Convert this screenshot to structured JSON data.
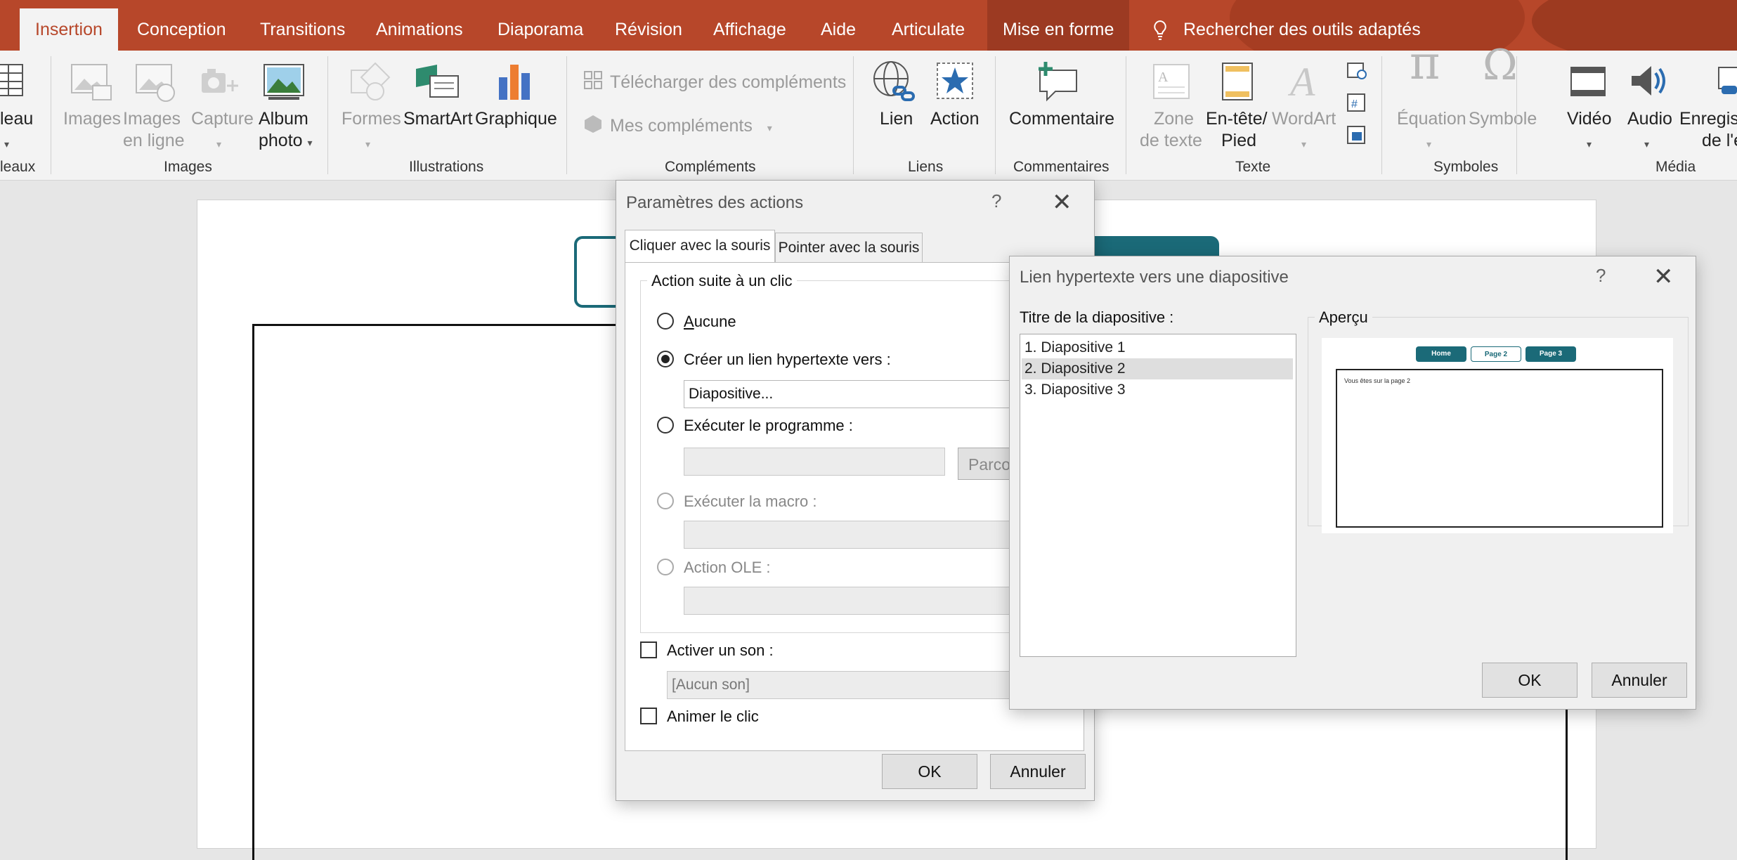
{
  "tabs": [
    "Insertion",
    "Conception",
    "Transitions",
    "Animations",
    "Diaporama",
    "Révision",
    "Affichage",
    "Aide",
    "Articulate",
    "Mise en forme"
  ],
  "search_text": "Rechercher des outils adaptés",
  "ribbon": {
    "tableau_partial": "leau",
    "tableaux_partial": "leaux",
    "images": "Images",
    "images_en_ligne_1": "Images",
    "images_en_ligne_2": "en ligne",
    "capture": "Capture",
    "album_photo_1": "Album",
    "album_photo_2": "photo",
    "group_images": "Images",
    "formes": "Formes",
    "smartart": "SmartArt",
    "graphique": "Graphique",
    "group_illustrations": "Illustrations",
    "telecharger": "Télécharger des compléments",
    "mes_complements": "Mes compléments",
    "group_complements": "Compléments",
    "lien": "Lien",
    "action": "Action",
    "group_liens": "Liens",
    "commentaire": "Commentaire",
    "group_commentaires": "Commentaires",
    "zone_texte_1": "Zone",
    "zone_texte_2": "de texte",
    "entete_1": "En-tête/",
    "entete_2": "Pied",
    "wordart": "WordArt",
    "group_texte": "Texte",
    "equation": "Équation",
    "symbole": "Symbole",
    "group_symboles": "Symboles",
    "video": "Vidéo",
    "audio": "Audio",
    "enregistrer_1": "Enregist",
    "enregistrer_2": "de l'é",
    "group_media": "Média"
  },
  "dialog_actions": {
    "title": "Paramètres des actions",
    "help": "?",
    "tab_click": "Cliquer avec la souris",
    "tab_hover": "Pointer avec la souris",
    "group_label": "Action suite à un clic",
    "opt_none": "Aucune",
    "opt_link": "Créer un lien hypertexte vers :",
    "link_value": "Diapositive...",
    "opt_program": "Exécuter le programme :",
    "browse": "Parcou",
    "opt_macro": "Exécuter la macro :",
    "opt_ole": "Action OLE :",
    "chk_sound": "Activer un son :",
    "sound_value": "[Aucun son]",
    "chk_animate": "Animer le clic",
    "ok": "OK",
    "cancel": "Annuler"
  },
  "dialog_link": {
    "title": "Lien hypertexte vers une diapositive",
    "help": "?",
    "list_label": "Titre de la diapositive :",
    "slides": [
      "1. Diapositive 1",
      "2. Diapositive 2",
      "3. Diapositive 3"
    ],
    "selected_index": 1,
    "preview_label": "Aperçu",
    "preview_buttons": [
      "Home",
      "Page 2",
      "Page 3"
    ],
    "preview_text": "Vous êtes sur la page 2",
    "ok": "OK",
    "cancel": "Annuler"
  },
  "colors": {
    "accent": "#b7472a",
    "teal": "#1b6a78",
    "ribbon_bg": "#f3f3f3"
  }
}
